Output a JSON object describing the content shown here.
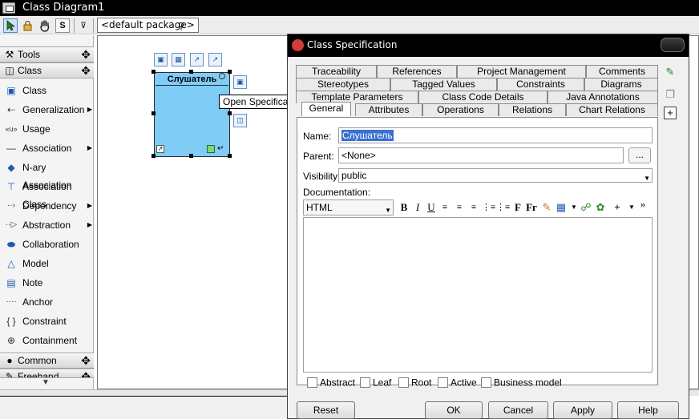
{
  "window": {
    "title": "Class Diagram1"
  },
  "toolbar": {
    "package_label": "<default package>",
    "stop_label": "S"
  },
  "palette": {
    "groups": [
      {
        "label": "Tools"
      },
      {
        "label": "Class"
      },
      {
        "label": "Common"
      },
      {
        "label": "Freehand"
      }
    ],
    "items": [
      {
        "label": "Class"
      },
      {
        "label": "Generalization"
      },
      {
        "label": "Usage"
      },
      {
        "label": "Association"
      },
      {
        "label": "N-ary Association"
      },
      {
        "label": "Association Class"
      },
      {
        "label": "Dependency"
      },
      {
        "label": "Abstraction"
      },
      {
        "label": "Collaboration"
      },
      {
        "label": "Model"
      },
      {
        "label": "Note"
      },
      {
        "label": "Anchor"
      },
      {
        "label": "Constraint"
      },
      {
        "label": "Containment"
      }
    ]
  },
  "canvas": {
    "class_name": "Слушатель",
    "tooltip": "Open Specification"
  },
  "dialog": {
    "title": "Class Specification",
    "tabs_row1": [
      "Traceability",
      "References",
      "Project Management",
      "Comments"
    ],
    "tabs_row2": [
      "Stereotypes",
      "Tagged Values",
      "Constraints",
      "Diagrams"
    ],
    "tabs_row3": [
      "Template Parameters",
      "Class Code Details",
      "Java Annotations"
    ],
    "tabs_row4": [
      "General",
      "Attributes",
      "Operations",
      "Relations",
      "Chart Relations"
    ],
    "active_tab": "General",
    "general": {
      "name_label": "Name:",
      "name_value": "Слушатель",
      "parent_label": "Parent:",
      "parent_value": "<None>",
      "parent_browse": "...",
      "visibility_label": "Visibility:",
      "visibility_value": "public",
      "documentation_label": "Documentation:",
      "doc_format": "HTML",
      "doc_toolbar": {
        "bold": "B",
        "italic": "I",
        "underline": "U",
        "font": "F",
        "font_size": "Fг",
        "more": "»"
      },
      "checkboxes": [
        {
          "label": "Abstract",
          "checked": false
        },
        {
          "label": "Leaf",
          "checked": false
        },
        {
          "label": "Root",
          "checked": false
        },
        {
          "label": "Active",
          "checked": false
        },
        {
          "label": "Business model",
          "checked": false
        }
      ]
    },
    "buttons": {
      "reset": "Reset",
      "ok": "OK",
      "cancel": "Cancel",
      "apply": "Apply",
      "help": "Help"
    }
  }
}
